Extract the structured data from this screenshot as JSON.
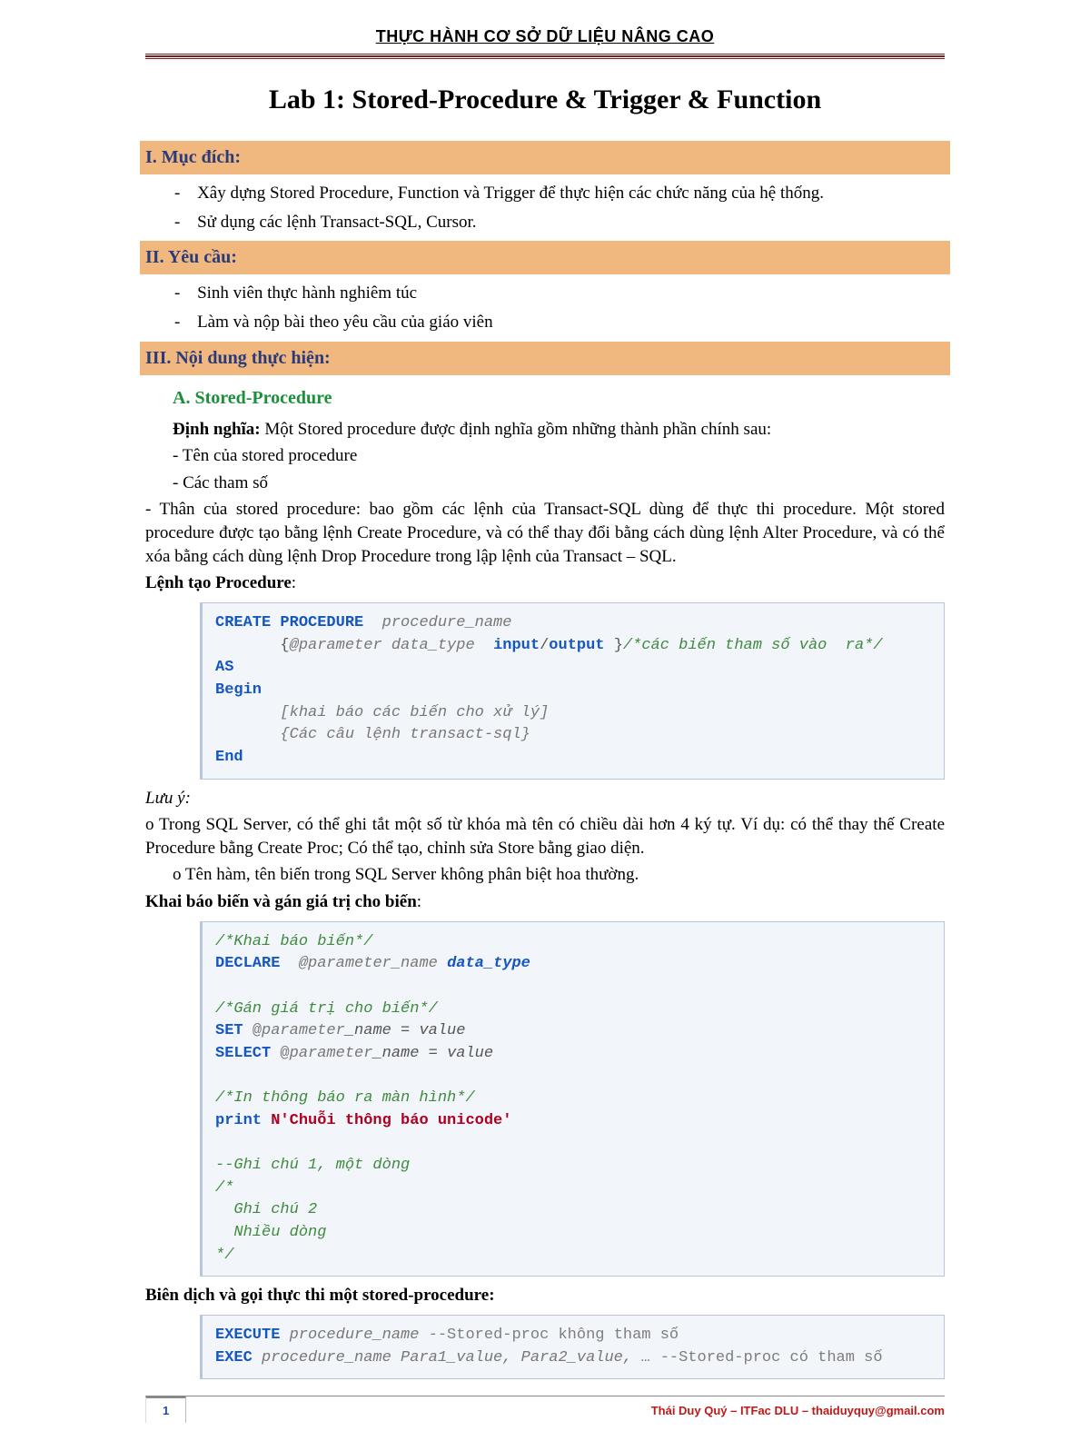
{
  "header": {
    "line_prefix": "THỰC HÀNH CƠ SỞ DỮ LIỆU ",
    "line_bold": "NÂNG CAO"
  },
  "title": "Lab 1: Stored-Procedure & Trigger & Function",
  "sections": {
    "s1": {
      "heading": "I. Mục đích:",
      "items": [
        "Xây dựng Stored Procedure, Function và Trigger để thực hiện các chức năng của hệ thống.",
        "Sử dụng các lệnh Transact-SQL, Cursor."
      ]
    },
    "s2": {
      "heading": "II. Yêu cầu:",
      "items": [
        "Sinh viên thực hành nghiêm túc",
        "Làm và nộp bài theo yêu cầu của giáo viên"
      ]
    },
    "s3": {
      "heading": "III. Nội dung thực hiện:"
    }
  },
  "stored_proc": {
    "sub_heading": "A.  Stored-Procedure",
    "def_label": "Định nghĩa:",
    "def_text": " Một Stored procedure được định nghĩa gồm những thành phần chính sau:",
    "b1": "- Tên của stored procedure",
    "b2": "- Các tham số",
    "b3": "- Thân của stored procedure: bao gồm các lệnh của Transact-SQL dùng để thực thi procedure. Một stored procedure được tạo bằng lệnh Create Procedure, và có thể thay đổi bằng cách dùng lệnh Alter Procedure, và có thể xóa bằng cách dùng lệnh Drop Procedure trong lập lệnh của Transact – SQL.",
    "lenh_tao_label": "Lệnh tạo Procedure",
    "code1": {
      "l1_kw": "CREATE PROCEDURE",
      "l1_name": "  procedure_name",
      "l2_open": "       {",
      "l2_param": "@parameter data_type",
      "l2_in": "  input",
      "l2_slash": "/",
      "l2_out": "output",
      "l2_close": " }",
      "l2_cmt": "/*các biến tham số vào  ra*/",
      "l3": "AS",
      "l4": "Begin",
      "l5": "       [khai báo các biến cho xử lý]",
      "l6": "       {Các câu lệnh transact-sql}",
      "l7": "End"
    },
    "luu_y_label": "Lưu ý:",
    "luu_y_1": "o Trong SQL Server, có thể ghi tắt một số từ khóa mà tên có chiều dài hơn 4 ký tự. Ví dụ: có thể thay thế Create Procedure bằng Create Proc; Có thể tạo, chỉnh sửa Store bằng giao diện.",
    "luu_y_2": "o Tên hàm, tên biến trong SQL Server không phân biệt hoa thường.",
    "khai_bao_label": "Khai báo biến và gán giá trị cho biến",
    "code2": {
      "c1": "/*Khai báo biến*/",
      "declare": "DECLARE",
      "decl_param": "  @parameter_name ",
      "decl_dt": "data_type",
      "c2": "/*Gán giá trị cho biến*/",
      "set": "SET ",
      "set_at": "@",
      "set_param": "parameter",
      "set_tail": "_name = value",
      "select": "SELECT ",
      "c3": "/*In thông báo ra màn hình*/",
      "print": "print ",
      "print_txt": "N'Chuỗi thông báo unicode'",
      "c4": "--Ghi chú 1, một dòng",
      "c5": "/*",
      "c6": "  Ghi chú 2",
      "c7": "  Nhiều dòng",
      "c8": "*/"
    },
    "bien_dich_label": "Biên dịch và gọi thực thi một stored-procedure:",
    "code3": {
      "exe": "EXECUTE",
      "exe_name": " procedure_name ",
      "exe_cmt": "--Stored-proc không tham số",
      "exec": "EXEC",
      "exec_name": " procedure_name Para1_value, Para2_value, … ",
      "exec_cmt": "--Stored-proc có tham số"
    }
  },
  "footer": {
    "page": "1",
    "right": "Thái Duy Quý – ITFac DLU – thaiduyquy@gmail.com"
  }
}
